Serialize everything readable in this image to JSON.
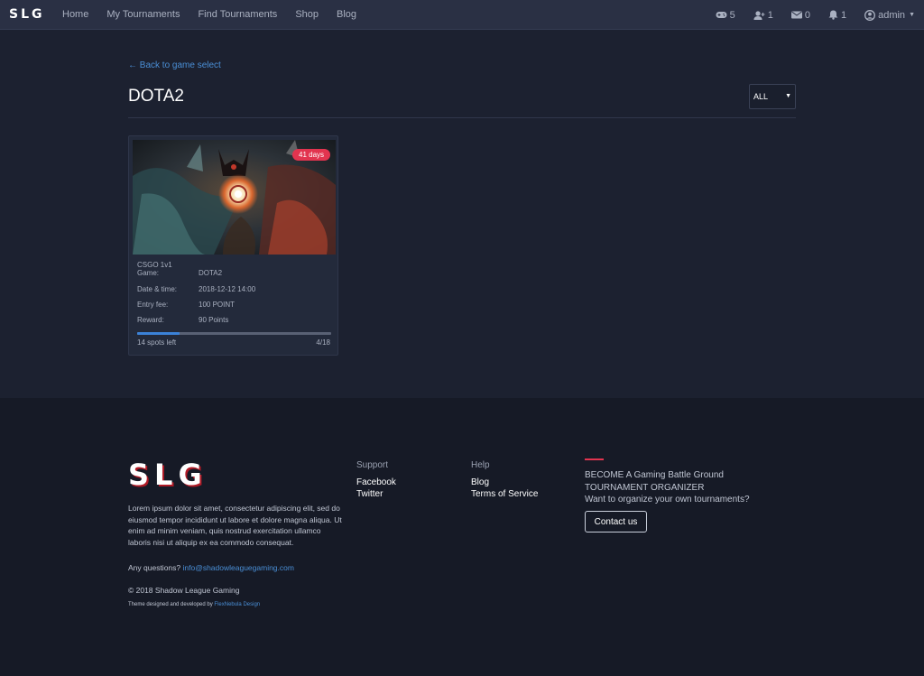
{
  "nav": {
    "brand": "SLG",
    "links": [
      "Home",
      "My Tournaments",
      "Find Tournaments",
      "Shop",
      "Blog"
    ],
    "stats": {
      "games": "5",
      "friends": "1",
      "messages": "0",
      "notifications": "1"
    },
    "user": "admin"
  },
  "main": {
    "back_link": "← Back to game select",
    "title": "DOTA2",
    "filter": "ALL"
  },
  "card": {
    "badge": "41 days",
    "name": "CSGO 1v1",
    "rows": [
      {
        "label": "Game:",
        "value": "DOTA2"
      },
      {
        "label": "Date & time:",
        "value": "2018-12-12 14:00"
      },
      {
        "label": "Entry fee:",
        "value": "100 POINT"
      },
      {
        "label": "Reward:",
        "value": "90 Points"
      }
    ],
    "progress_fraction": 0.22,
    "spots_left": "14 spots left",
    "count": "4/18"
  },
  "footer": {
    "logo": "SLG",
    "about": "Lorem ipsum dolor sit amet, consectetur adipiscing elit, sed do eiusmod tempor incididunt ut labore et dolore magna aliqua. Ut enim ad minim veniam, quis nostrud exercitation ullamco laboris nisi ut aliquip ex ea commodo consequat.",
    "questions_label": "Any questions?",
    "email": "info@shadowleaguegaming.com",
    "copyright": "© 2018 Shadow League Gaming",
    "credit_label": "Theme designed and developed by",
    "credit_link": "FlexNebula Design",
    "support": {
      "heading": "Support",
      "links": [
        "Facebook",
        "Twitter"
      ]
    },
    "help": {
      "heading": "Help",
      "links": [
        "Blog",
        "Terms of Service"
      ]
    },
    "cta": {
      "line1": "BECOME A Gaming Battle Ground",
      "line2": "TOURNAMENT ORGANIZER",
      "line3": "Want to organize your own tournaments?",
      "button": "Contact us"
    }
  },
  "colors": {
    "accent_red": "#e2344f",
    "link_blue": "#4a8fd6",
    "progress_blue": "#3b82d8"
  }
}
